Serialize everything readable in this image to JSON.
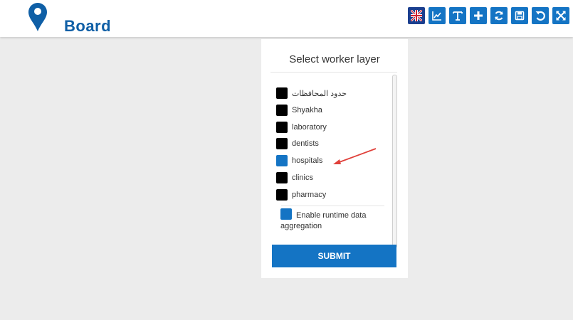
{
  "header": {
    "logo_text": "Board",
    "toolbar": [
      {
        "icon": "uk-flag-icon"
      },
      {
        "icon": "line-chart-icon"
      },
      {
        "icon": "text-icon"
      },
      {
        "icon": "plus-icon"
      },
      {
        "icon": "refresh-icon"
      },
      {
        "icon": "save-icon"
      },
      {
        "icon": "undo-icon"
      },
      {
        "icon": "fullscreen-icon"
      }
    ]
  },
  "panel": {
    "title": "Select worker layer",
    "layers": [
      {
        "label": "حدود المحافظات",
        "checked": false
      },
      {
        "label": "Shyakha",
        "checked": false
      },
      {
        "label": "laboratory",
        "checked": false
      },
      {
        "label": "dentists",
        "checked": false
      },
      {
        "label": "hospitals",
        "checked": true
      },
      {
        "label": "clinics",
        "checked": false
      },
      {
        "label": "pharmacy",
        "checked": false
      }
    ],
    "aggregation_label": "Enable runtime data aggregation",
    "aggregation_checked": true,
    "submit_label": "SUBMIT"
  },
  "colors": {
    "accent": "#1474c4",
    "annotation_arrow": "#e0403a"
  }
}
